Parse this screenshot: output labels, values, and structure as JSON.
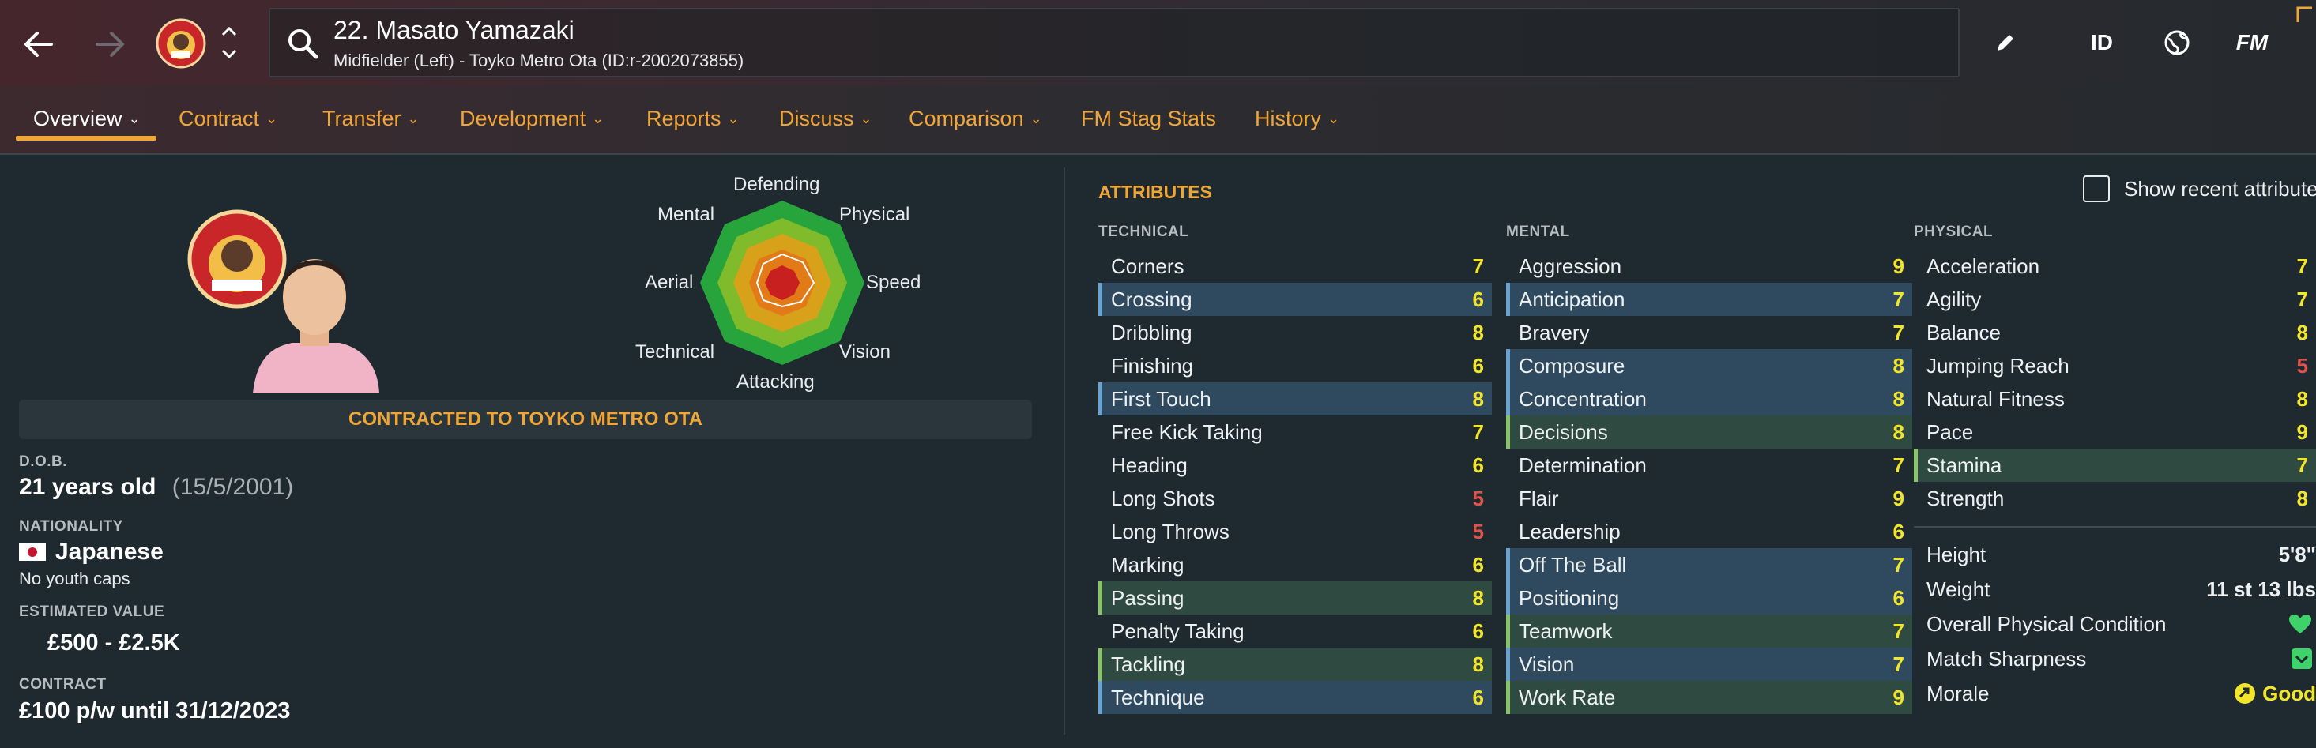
{
  "colors": {
    "accent": "#f0a637",
    "value_high": "#f2e52b",
    "value_mid": "#f2e52b",
    "value_low": "#e0534a",
    "text": "#eef1f2"
  },
  "header": {
    "player_title": "22. Masato Yamazaki",
    "player_subtitle": "Midfielder (Left) - Toyko Metro Ota (ID:r-2002073855)",
    "id_label": "ID",
    "fm_label": "FM",
    "icons": [
      "back-arrow-icon",
      "forward-arrow-icon",
      "club-badge",
      "chevron-up-icon",
      "chevron-down-icon",
      "search-icon",
      "pencil-icon",
      "globe-icon"
    ]
  },
  "tabs": [
    {
      "label": "Overview",
      "active": true
    },
    {
      "label": "Contract"
    },
    {
      "label": "Transfer"
    },
    {
      "label": "Development"
    },
    {
      "label": "Reports"
    },
    {
      "label": "Discuss"
    },
    {
      "label": "Comparison"
    },
    {
      "label": "FM Stag Stats"
    },
    {
      "label": "History"
    }
  ],
  "profile": {
    "contract_banner": "CONTRACTED TO TOYKO METRO OTA",
    "dob_label": "D.O.B.",
    "age": "21 years old",
    "dob": "(15/5/2001)",
    "nationality_label": "NATIONALITY",
    "nationality": "Japanese",
    "youth_caps": "No youth caps",
    "value_label": "ESTIMATED VALUE",
    "value": "£500 - £2.5K",
    "contract_label": "CONTRACT",
    "contract": "£100 p/w until 31/12/2023"
  },
  "radar": {
    "labels": {
      "defending": "Defending",
      "physical": "Physical",
      "speed": "Speed",
      "vision": "Vision",
      "attacking": "Attacking",
      "technical": "Technical",
      "aerial": "Aerial",
      "mental": "Mental"
    }
  },
  "attributes": {
    "title": "ATTRIBUTES",
    "show_recent": "Show recent attributes",
    "technical_label": "TECHNICAL",
    "mental_label": "MENTAL",
    "physical_label": "PHYSICAL",
    "technical": [
      {
        "name": "Corners",
        "value": "7",
        "hl": ""
      },
      {
        "name": "Crossing",
        "value": "6",
        "hl": "blue"
      },
      {
        "name": "Dribbling",
        "value": "8",
        "hl": ""
      },
      {
        "name": "Finishing",
        "value": "6",
        "hl": ""
      },
      {
        "name": "First Touch",
        "value": "8",
        "hl": "blue"
      },
      {
        "name": "Free Kick Taking",
        "value": "7",
        "hl": ""
      },
      {
        "name": "Heading",
        "value": "6",
        "hl": ""
      },
      {
        "name": "Long Shots",
        "value": "5",
        "hl": ""
      },
      {
        "name": "Long Throws",
        "value": "5",
        "hl": ""
      },
      {
        "name": "Marking",
        "value": "6",
        "hl": ""
      },
      {
        "name": "Passing",
        "value": "8",
        "hl": "green"
      },
      {
        "name": "Penalty Taking",
        "value": "6",
        "hl": ""
      },
      {
        "name": "Tackling",
        "value": "8",
        "hl": "green"
      },
      {
        "name": "Technique",
        "value": "6",
        "hl": "blue"
      }
    ],
    "mental": [
      {
        "name": "Aggression",
        "value": "9",
        "hl": ""
      },
      {
        "name": "Anticipation",
        "value": "7",
        "hl": "blue"
      },
      {
        "name": "Bravery",
        "value": "7",
        "hl": ""
      },
      {
        "name": "Composure",
        "value": "8",
        "hl": "blue"
      },
      {
        "name": "Concentration",
        "value": "8",
        "hl": "blue"
      },
      {
        "name": "Decisions",
        "value": "8",
        "hl": "green"
      },
      {
        "name": "Determination",
        "value": "7",
        "hl": ""
      },
      {
        "name": "Flair",
        "value": "9",
        "hl": ""
      },
      {
        "name": "Leadership",
        "value": "6",
        "hl": ""
      },
      {
        "name": "Off The Ball",
        "value": "7",
        "hl": "blue"
      },
      {
        "name": "Positioning",
        "value": "6",
        "hl": "blue"
      },
      {
        "name": "Teamwork",
        "value": "7",
        "hl": "green"
      },
      {
        "name": "Vision",
        "value": "7",
        "hl": "blue"
      },
      {
        "name": "Work Rate",
        "value": "9",
        "hl": "green"
      }
    ],
    "physical": [
      {
        "name": "Acceleration",
        "value": "7",
        "hl": ""
      },
      {
        "name": "Agility",
        "value": "7",
        "hl": ""
      },
      {
        "name": "Balance",
        "value": "8",
        "hl": ""
      },
      {
        "name": "Jumping Reach",
        "value": "5",
        "hl": ""
      },
      {
        "name": "Natural Fitness",
        "value": "8",
        "hl": ""
      },
      {
        "name": "Pace",
        "value": "9",
        "hl": ""
      },
      {
        "name": "Stamina",
        "value": "7",
        "hl": "green"
      },
      {
        "name": "Strength",
        "value": "8",
        "hl": ""
      }
    ],
    "info": {
      "height_label": "Height",
      "height": "5'8\"",
      "weight_label": "Weight",
      "weight": "11 st 13 lbs",
      "condition_label": "Overall Physical Condition",
      "sharpness_label": "Match Sharpness",
      "morale_label": "Morale",
      "morale": "Good"
    }
  }
}
